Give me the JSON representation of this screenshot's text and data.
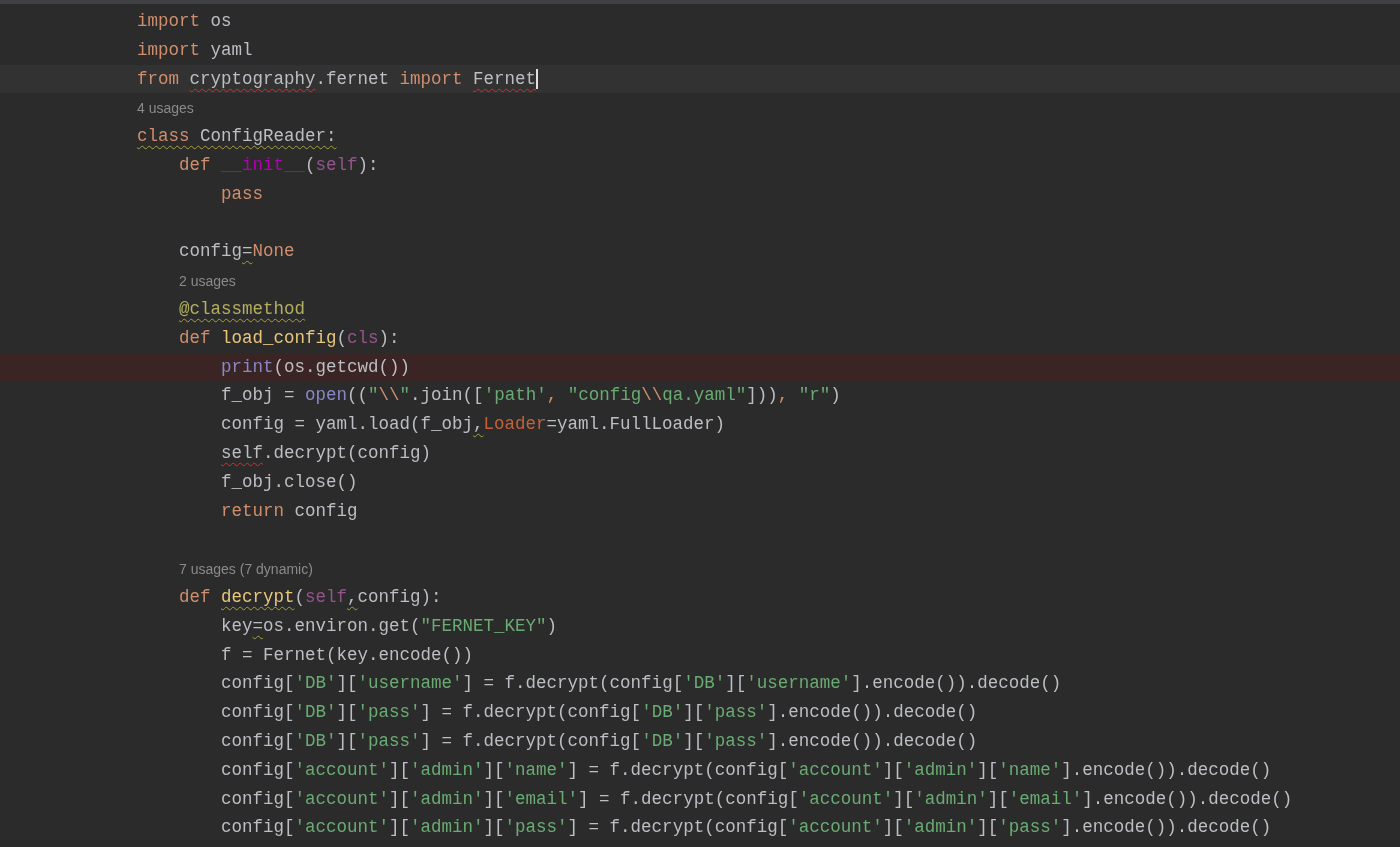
{
  "editor": {
    "lines": [
      {
        "kind": "code",
        "tokens": [
          {
            "kind": "keyword",
            "text": "import "
          },
          {
            "kind": "plain",
            "text": "os"
          }
        ]
      },
      {
        "kind": "code",
        "tokens": [
          {
            "kind": "keyword",
            "text": "import "
          },
          {
            "kind": "plain",
            "text": "yaml"
          }
        ]
      },
      {
        "kind": "code",
        "current": true,
        "caret": true,
        "tokens": [
          {
            "kind": "keyword",
            "text": "from "
          },
          {
            "kind": "plain",
            "text": "cryptography",
            "error": true
          },
          {
            "kind": "plain",
            "text": ".fernet "
          },
          {
            "kind": "keyword",
            "text": "import "
          },
          {
            "kind": "plain",
            "text": "Fernet",
            "error": true
          }
        ]
      },
      {
        "kind": "hint",
        "text": "4 usages"
      },
      {
        "kind": "code",
        "tokens": [
          {
            "kind": "keyword",
            "text": "class ",
            "warning": true
          },
          {
            "kind": "plain",
            "text": "ConfigReader:",
            "warning": true
          }
        ]
      },
      {
        "kind": "code",
        "tokens": [
          {
            "kind": "keyword",
            "text": "    def "
          },
          {
            "kind": "magic",
            "text": "__init__"
          },
          {
            "kind": "plain",
            "text": "("
          },
          {
            "kind": "param",
            "text": "self"
          },
          {
            "kind": "plain",
            "text": "):"
          }
        ]
      },
      {
        "kind": "code",
        "tokens": [
          {
            "kind": "keyword",
            "text": "        pass"
          }
        ]
      },
      {
        "kind": "blank"
      },
      {
        "kind": "code",
        "tokens": [
          {
            "kind": "plain",
            "text": "    config"
          },
          {
            "kind": "plain",
            "text": "=",
            "warning": true
          },
          {
            "kind": "keyword",
            "text": "None"
          }
        ]
      },
      {
        "kind": "hint",
        "text": "    2 usages"
      },
      {
        "kind": "code",
        "tokens": [
          {
            "kind": "decorator",
            "text": "    @classmethod",
            "warning": true
          }
        ]
      },
      {
        "kind": "code",
        "tokens": [
          {
            "kind": "keyword",
            "text": "    def "
          },
          {
            "kind": "function",
            "text": "load_config"
          },
          {
            "kind": "plain",
            "text": "("
          },
          {
            "kind": "param",
            "text": "cls"
          },
          {
            "kind": "plain",
            "text": "):"
          }
        ]
      },
      {
        "kind": "code",
        "alert": true,
        "tokens": [
          {
            "kind": "builtin",
            "text": "        print"
          },
          {
            "kind": "plain",
            "text": "(os.getcwd())"
          }
        ]
      },
      {
        "kind": "code",
        "tokens": [
          {
            "kind": "plain",
            "text": "        f_obj = "
          },
          {
            "kind": "builtin",
            "text": "open"
          },
          {
            "kind": "plain",
            "text": "(("
          },
          {
            "kind": "string",
            "text": "\""
          },
          {
            "kind": "escape",
            "text": "\\\\"
          },
          {
            "kind": "string",
            "text": "\""
          },
          {
            "kind": "plain",
            "text": ".join(["
          },
          {
            "kind": "string",
            "text": "'path'"
          },
          {
            "kind": "keyword",
            "text": ", "
          },
          {
            "kind": "string",
            "text": "\"config"
          },
          {
            "kind": "escape",
            "text": "\\\\"
          },
          {
            "kind": "string",
            "text": "qa.yaml\""
          },
          {
            "kind": "plain",
            "text": "]))"
          },
          {
            "kind": "keyword",
            "text": ", "
          },
          {
            "kind": "string",
            "text": "\"r\""
          },
          {
            "kind": "plain",
            "text": ")"
          }
        ]
      },
      {
        "kind": "code",
        "tokens": [
          {
            "kind": "plain",
            "text": "        config = yaml.load(f_obj"
          },
          {
            "kind": "plain",
            "text": ",",
            "warning": true
          },
          {
            "kind": "kwarg",
            "text": "Loader"
          },
          {
            "kind": "plain",
            "text": "=yaml.FullLoader)"
          }
        ]
      },
      {
        "kind": "code",
        "tokens": [
          {
            "kind": "plain",
            "text": "        self",
            "error": true
          },
          {
            "kind": "plain",
            "text": ".decrypt(config)"
          }
        ]
      },
      {
        "kind": "code",
        "tokens": [
          {
            "kind": "plain",
            "text": "        f_obj.close()"
          }
        ]
      },
      {
        "kind": "code",
        "tokens": [
          {
            "kind": "keyword",
            "text": "        return "
          },
          {
            "kind": "plain",
            "text": "config"
          }
        ]
      },
      {
        "kind": "blank"
      },
      {
        "kind": "hint",
        "text": "    7 usages (7 dynamic)"
      },
      {
        "kind": "code",
        "tokens": [
          {
            "kind": "keyword",
            "text": "    def "
          },
          {
            "kind": "function",
            "text": "decrypt",
            "warning": true
          },
          {
            "kind": "plain",
            "text": "("
          },
          {
            "kind": "param",
            "text": "self"
          },
          {
            "kind": "plain",
            "text": ",",
            "warning": true
          },
          {
            "kind": "plain",
            "text": "config):"
          }
        ]
      },
      {
        "kind": "code",
        "tokens": [
          {
            "kind": "plain",
            "text": "        key"
          },
          {
            "kind": "plain",
            "text": "=",
            "warning": true
          },
          {
            "kind": "plain",
            "text": "os.environ.get("
          },
          {
            "kind": "string",
            "text": "\"FERNET_KEY\""
          },
          {
            "kind": "plain",
            "text": ")"
          }
        ]
      },
      {
        "kind": "code",
        "tokens": [
          {
            "kind": "plain",
            "text": "        f = Fernet(key.encode())"
          }
        ]
      },
      {
        "kind": "code",
        "tokens": [
          {
            "kind": "plain",
            "text": "        config["
          },
          {
            "kind": "string",
            "text": "'DB'"
          },
          {
            "kind": "plain",
            "text": "]["
          },
          {
            "kind": "string",
            "text": "'username'"
          },
          {
            "kind": "plain",
            "text": "] = f.decrypt(config["
          },
          {
            "kind": "string",
            "text": "'DB'"
          },
          {
            "kind": "plain",
            "text": "]["
          },
          {
            "kind": "string",
            "text": "'username'"
          },
          {
            "kind": "plain",
            "text": "].encode()).decode()"
          }
        ]
      },
      {
        "kind": "code",
        "tokens": [
          {
            "kind": "plain",
            "text": "        config["
          },
          {
            "kind": "string",
            "text": "'DB'"
          },
          {
            "kind": "plain",
            "text": "]["
          },
          {
            "kind": "string",
            "text": "'pass'"
          },
          {
            "kind": "plain",
            "text": "] = f.decrypt(config["
          },
          {
            "kind": "string",
            "text": "'DB'"
          },
          {
            "kind": "plain",
            "text": "]["
          },
          {
            "kind": "string",
            "text": "'pass'"
          },
          {
            "kind": "plain",
            "text": "].encode()).decode()"
          }
        ]
      },
      {
        "kind": "code",
        "tokens": [
          {
            "kind": "plain",
            "text": "        config["
          },
          {
            "kind": "string",
            "text": "'DB'"
          },
          {
            "kind": "plain",
            "text": "]["
          },
          {
            "kind": "string",
            "text": "'pass'"
          },
          {
            "kind": "plain",
            "text": "] = f.decrypt(config["
          },
          {
            "kind": "string",
            "text": "'DB'"
          },
          {
            "kind": "plain",
            "text": "]["
          },
          {
            "kind": "string",
            "text": "'pass'"
          },
          {
            "kind": "plain",
            "text": "].encode()).decode()"
          }
        ]
      },
      {
        "kind": "code",
        "tokens": [
          {
            "kind": "plain",
            "text": "        config["
          },
          {
            "kind": "string",
            "text": "'account'"
          },
          {
            "kind": "plain",
            "text": "]["
          },
          {
            "kind": "string",
            "text": "'admin'"
          },
          {
            "kind": "plain",
            "text": "]["
          },
          {
            "kind": "string",
            "text": "'name'"
          },
          {
            "kind": "plain",
            "text": "] = f.decrypt(config["
          },
          {
            "kind": "string",
            "text": "'account'"
          },
          {
            "kind": "plain",
            "text": "]["
          },
          {
            "kind": "string",
            "text": "'admin'"
          },
          {
            "kind": "plain",
            "text": "]["
          },
          {
            "kind": "string",
            "text": "'name'"
          },
          {
            "kind": "plain",
            "text": "].encode()).decode()"
          }
        ]
      },
      {
        "kind": "code",
        "tokens": [
          {
            "kind": "plain",
            "text": "        config["
          },
          {
            "kind": "string",
            "text": "'account'"
          },
          {
            "kind": "plain",
            "text": "]["
          },
          {
            "kind": "string",
            "text": "'admin'"
          },
          {
            "kind": "plain",
            "text": "]["
          },
          {
            "kind": "string",
            "text": "'email'"
          },
          {
            "kind": "plain",
            "text": "] = f.decrypt(config["
          },
          {
            "kind": "string",
            "text": "'account'"
          },
          {
            "kind": "plain",
            "text": "]["
          },
          {
            "kind": "string",
            "text": "'admin'"
          },
          {
            "kind": "plain",
            "text": "]["
          },
          {
            "kind": "string",
            "text": "'email'"
          },
          {
            "kind": "plain",
            "text": "].encode()).decode()"
          }
        ]
      },
      {
        "kind": "code",
        "tokens": [
          {
            "kind": "plain",
            "text": "        config["
          },
          {
            "kind": "string",
            "text": "'account'"
          },
          {
            "kind": "plain",
            "text": "]["
          },
          {
            "kind": "string",
            "text": "'admin'"
          },
          {
            "kind": "plain",
            "text": "]["
          },
          {
            "kind": "string",
            "text": "'pass'"
          },
          {
            "kind": "plain",
            "text": "] = f.decrypt(config["
          },
          {
            "kind": "string",
            "text": "'account'"
          },
          {
            "kind": "plain",
            "text": "]["
          },
          {
            "kind": "string",
            "text": "'admin'"
          },
          {
            "kind": "plain",
            "text": "]["
          },
          {
            "kind": "string",
            "text": "'pass'"
          },
          {
            "kind": "plain",
            "text": "].encode()).decode()"
          }
        ]
      }
    ]
  }
}
